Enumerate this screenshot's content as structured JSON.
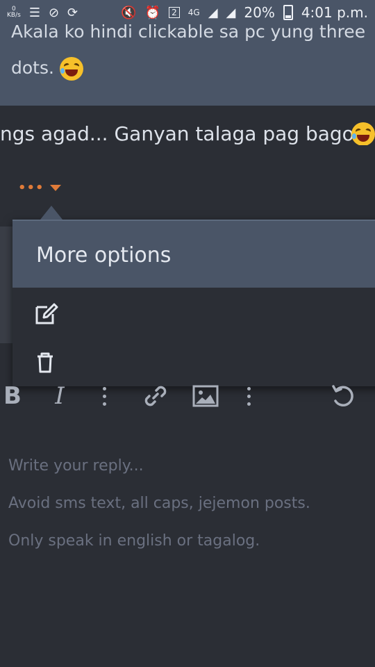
{
  "status_bar": {
    "net_speed_value": "0",
    "net_speed_unit": "KB/s",
    "network": "4G",
    "sim": "2",
    "battery": "20%",
    "time": "4:01 p.m."
  },
  "quote": {
    "text_line1": "Akala ko hindi clickable sa pc yung three",
    "text_line2": "dots."
  },
  "post": {
    "text": "ngs agad... Ganyan talaga pag bago"
  },
  "post_actions": {
    "more": "•••"
  },
  "dropdown": {
    "title": "More options",
    "items": [
      {
        "icon": "edit-icon"
      },
      {
        "icon": "trash-icon"
      }
    ]
  },
  "toolbar": {
    "bold": "B",
    "italic": "I"
  },
  "reply": {
    "placeholder_line1": "Write your reply...",
    "placeholder_line2": "Avoid sms text, all caps, jejemon posts.",
    "placeholder_line3": "Only speak in english or tagalog."
  },
  "colors": {
    "accent": "#e07b39",
    "quote_bg": "#4a5567",
    "page_bg": "#2b2e35"
  }
}
